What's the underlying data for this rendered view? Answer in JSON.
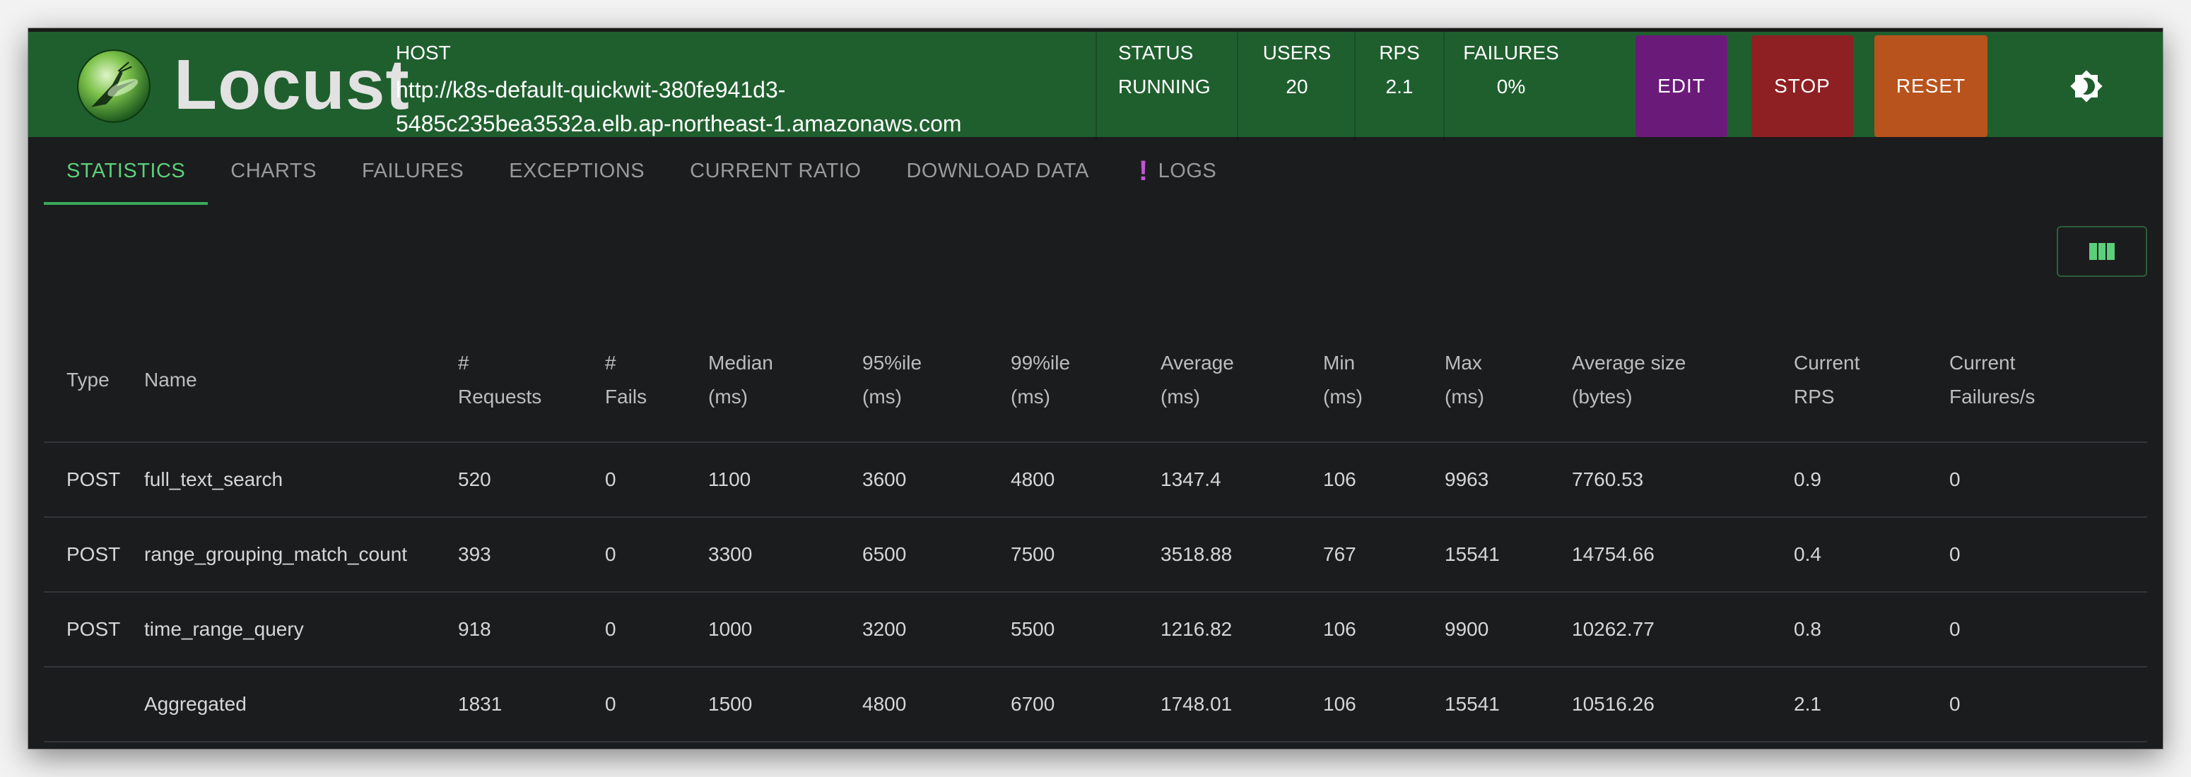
{
  "app": {
    "name": "Locust"
  },
  "host": {
    "label": "HOST",
    "line1": "http://k8s-default-quickwit-380fe941d3-",
    "line2": "5485c235bea3532a.elb.ap-northeast-1.amazonaws.com"
  },
  "stats": {
    "status": {
      "label": "STATUS",
      "value": "RUNNING"
    },
    "users": {
      "label": "USERS",
      "value": "20"
    },
    "rps": {
      "label": "RPS",
      "value": "2.1"
    },
    "failures": {
      "label": "FAILURES",
      "value": "0%"
    }
  },
  "buttons": {
    "edit": "EDIT",
    "stop": "STOP",
    "reset": "RESET"
  },
  "colors": {
    "header_bg": "#1f5f2e",
    "edit": "#6a1b7a",
    "stop": "#8e2023",
    "reset": "#b8531d",
    "accent": "#5ccf7a",
    "logs_warning": "#c056d6"
  },
  "icons": {
    "logo": "locust-logo-icon",
    "theme": "theme-toggle-icon",
    "columns": "view-columns-icon",
    "warning": "exclamation-icon"
  },
  "tabs": [
    {
      "label": "STATISTICS",
      "active": true
    },
    {
      "label": "CHARTS"
    },
    {
      "label": "FAILURES"
    },
    {
      "label": "EXCEPTIONS"
    },
    {
      "label": "CURRENT RATIO"
    },
    {
      "label": "DOWNLOAD DATA"
    },
    {
      "label": "LOGS",
      "warning": "!"
    }
  ],
  "table": {
    "headers": [
      [
        "Type"
      ],
      [
        "Name"
      ],
      [
        "#",
        "Requests"
      ],
      [
        "#",
        "Fails"
      ],
      [
        "Median",
        "(ms)"
      ],
      [
        "95%ile",
        "(ms)"
      ],
      [
        "99%ile",
        "(ms)"
      ],
      [
        "Average",
        "(ms)"
      ],
      [
        "Min",
        "(ms)"
      ],
      [
        "Max",
        "(ms)"
      ],
      [
        "Average size",
        "(bytes)"
      ],
      [
        "Current",
        "RPS"
      ],
      [
        "Current",
        "Failures/s"
      ]
    ],
    "rows": [
      [
        "POST",
        "full_text_search",
        "520",
        "0",
        "1100",
        "3600",
        "4800",
        "1347.4",
        "106",
        "9963",
        "7760.53",
        "0.9",
        "0"
      ],
      [
        "POST",
        "range_grouping_match_count",
        "393",
        "0",
        "3300",
        "6500",
        "7500",
        "3518.88",
        "767",
        "15541",
        "14754.66",
        "0.4",
        "0"
      ],
      [
        "POST",
        "time_range_query",
        "918",
        "0",
        "1000",
        "3200",
        "5500",
        "1216.82",
        "106",
        "9900",
        "10262.77",
        "0.8",
        "0"
      ],
      [
        "",
        "Aggregated",
        "1831",
        "0",
        "1500",
        "4800",
        "6700",
        "1748.01",
        "106",
        "15541",
        "10516.26",
        "2.1",
        "0"
      ]
    ]
  }
}
